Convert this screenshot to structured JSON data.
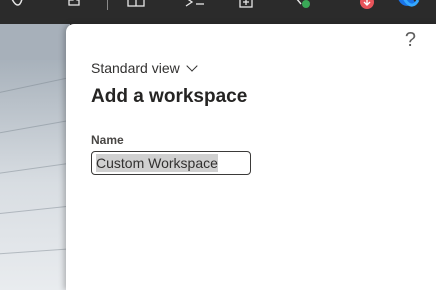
{
  "toolbar": {
    "icons": [
      "curved-arrow-icon",
      "extensions-icon",
      "split-screen-icon",
      "reading-list-icon",
      "collections-icon",
      "performance-icon",
      "downloads-icon",
      "copilot-icon"
    ],
    "accent_green": "#3aa757",
    "accent_red": "#e8545a",
    "copilot_blue": "#1a73e8"
  },
  "pane": {
    "help_label": "?",
    "view_label": "Standard view",
    "title": "Add a workspace",
    "name_label": "Name",
    "name_value": "Custom Workspace"
  }
}
